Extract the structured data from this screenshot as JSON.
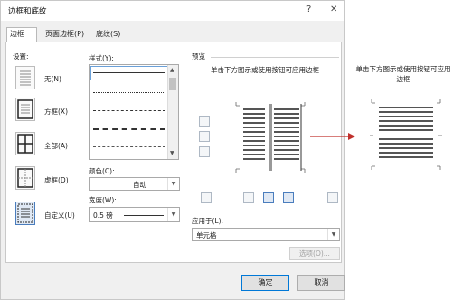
{
  "dialog": {
    "title": "边框和底纹",
    "help_btn": "?",
    "close_btn": "✕"
  },
  "tabs": [
    {
      "label": "边框(B)",
      "active": true
    },
    {
      "label": "页面边框(P)",
      "active": false
    },
    {
      "label": "底纹(S)",
      "active": false
    }
  ],
  "settings": {
    "header": "设置:",
    "items": [
      {
        "label": "无(N)"
      },
      {
        "label": "方框(X)"
      },
      {
        "label": "全部(A)"
      },
      {
        "label": "虚框(D)"
      },
      {
        "label": "自定义(U)"
      }
    ]
  },
  "style": {
    "header": "样式(Y):"
  },
  "color": {
    "label": "颜色(C):",
    "value": "自动"
  },
  "width": {
    "label": "宽度(W):",
    "value": "0.5 磅"
  },
  "preview": {
    "header": "预览",
    "hint": "单击下方图示或使用按钮可应用边框"
  },
  "apply_to": {
    "label": "应用于(L):",
    "value": "单元格"
  },
  "options_button": "选项(O)...",
  "ok_button": "确定",
  "cancel_button": "取消",
  "side_preview": {
    "hint": "单击下方图示或使用按钮可应用边框"
  },
  "colors": {
    "arrow": "#c0302c",
    "accent": "#0078d7"
  }
}
